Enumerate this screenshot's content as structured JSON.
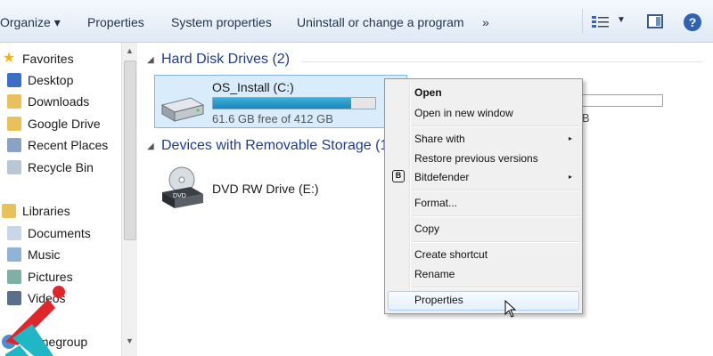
{
  "toolbar": {
    "organize": "Organize ▾",
    "properties": "Properties",
    "system_properties": "System properties",
    "uninstall": "Uninstall or change a program",
    "more": "»",
    "help": "?"
  },
  "nav": {
    "favorites": "Favorites",
    "desktop": "Desktop",
    "downloads": "Downloads",
    "google_drive": "Google Drive",
    "recent_places": "Recent Places",
    "recycle_bin": "Recycle Bin",
    "libraries": "Libraries",
    "documents": "Documents",
    "music": "Music",
    "pictures": "Pictures",
    "videos": "Videos",
    "homegroup": "Homegroup"
  },
  "content": {
    "hdd_header": "Hard Disk Drives (2)",
    "removable_header": "Devices with Removable Storage (1",
    "drive1": {
      "name": "OS_Install (C:)",
      "free": "61.6 GB free of 412 GB",
      "used_fraction": 0.85
    },
    "drive2": {
      "free_fragment": "B"
    },
    "dvd": {
      "name": "DVD RW Drive (E:)",
      "icon_label": "DVD"
    }
  },
  "context_menu": {
    "open": "Open",
    "open_new_window": "Open in new window",
    "share_with": "Share with",
    "restore_previous": "Restore previous versions",
    "bitdefender": "Bitdefender",
    "bitdefender_icon": "B",
    "format": "Format...",
    "copy": "Copy",
    "create_shortcut": "Create shortcut",
    "rename": "Rename",
    "properties": "Properties",
    "submenu_arrow": "▸"
  },
  "colors": {
    "accent": "#1e3d8f",
    "selection": "#d9ecfb",
    "bar": "#1a86b8",
    "logo_red": "#e0262b",
    "logo_teal": "#1fb7c6"
  }
}
